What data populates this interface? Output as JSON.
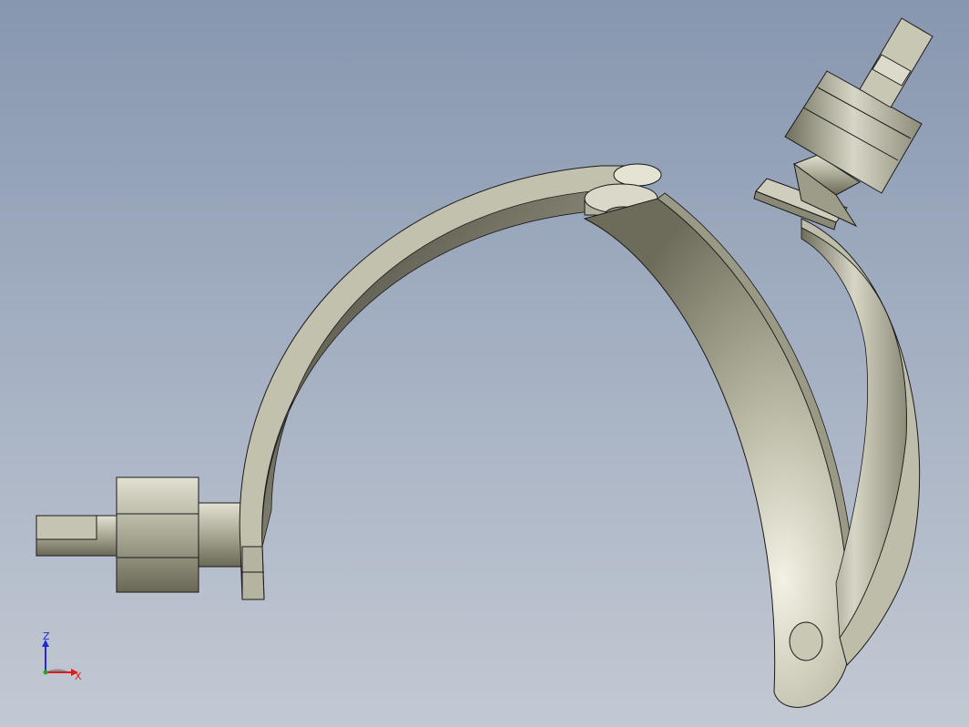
{
  "viewport": {
    "background_top": "#8797af",
    "background_bottom": "#c3c9d3"
  },
  "model": {
    "part_color": "#b9b8a4",
    "edge_color": "#1a1a1a"
  },
  "triad": {
    "z_label": "Z",
    "x_label": "X",
    "z_color": "#1f2bd6",
    "x_color": "#d81e1e"
  }
}
